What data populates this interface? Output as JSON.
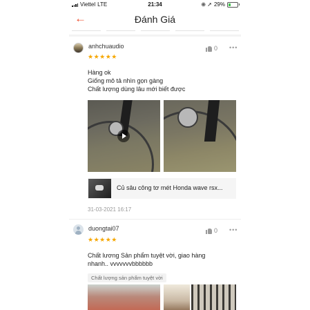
{
  "status_bar": {
    "carrier": "Viettel",
    "network": "LTE",
    "time": "21:34",
    "battery": "29%",
    "battery_fraction": 0.29
  },
  "header": {
    "title": "Đánh Giá",
    "back_icon": "arrow-left-icon"
  },
  "colors": {
    "accent": "#ee4d2d",
    "star": "#f6a700"
  },
  "reviews": [
    {
      "username": "anhchuaudio",
      "rating": 5,
      "stars": "★★★★★",
      "likes": "0",
      "more": "•••",
      "lines": [
        "Hàng ok",
        "Giống mô tả nhìn gọn gàng",
        "Chất lượng dùng lâu mới biết được"
      ],
      "media": [
        "video",
        "photo"
      ],
      "product_name": "Củ sâu công tơ mét Honda wave rsx...",
      "date": "31-03-2021 16:17"
    },
    {
      "username": "duongtai07",
      "rating": 5,
      "stars": "★★★★★",
      "likes": "0",
      "more": "•••",
      "lines": [
        "Chất lương Sản phẩm tuyệt vời, giao hàng",
        "nhanh.. vvvvvvvbbbbbb"
      ],
      "tag": "Chất lượng sản phẩm tuyệt vời"
    }
  ]
}
